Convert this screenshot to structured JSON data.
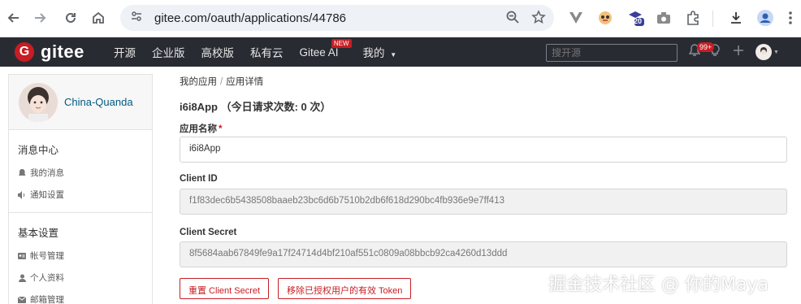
{
  "browser": {
    "url": "gitee.com/oauth/applications/44786",
    "extension_badge": "20"
  },
  "gitee_header": {
    "logo_text": "gitee",
    "logo_letter": "G",
    "nav": [
      "开源",
      "企业版",
      "高校版",
      "私有云",
      "Gitee AI",
      "我的"
    ],
    "new_tag": "NEW",
    "search_placeholder": "搜开源",
    "notification_badge": "99+"
  },
  "sidebar": {
    "username": "China-Quanda",
    "groups": [
      {
        "title": "消息中心",
        "items": [
          "我的消息",
          "通知设置"
        ]
      },
      {
        "title": "基本设置",
        "items": [
          "帐号管理",
          "个人资料",
          "邮箱管理"
        ]
      }
    ]
  },
  "breadcrumb": {
    "parent": "我的应用",
    "separator": "/",
    "current": "应用详情"
  },
  "app": {
    "title": "i6i8App （今日请求次数: 0 次）",
    "name_label": "应用名称",
    "required_mark": "*",
    "name_value": "i6i8App",
    "client_id_label": "Client ID",
    "client_id_value": "f1f83dec6b5438508baaeb23bc6d6b7510b2db6f618d290bc4fb936e9e7ff413",
    "client_secret_label": "Client Secret",
    "client_secret_value": "8f5684aab67849fe9a17f24714d4bf210af551c0809a08bbcb92ca4260d13ddd"
  },
  "buttons": {
    "reset_secret": "重置 Client Secret",
    "revoke_tokens": "移除已授权用户的有效 Token"
  },
  "watermark": "掘金技术社区 @ 你的Maya",
  "colors": {
    "brand": "#c71d23",
    "header_bg": "#292b33",
    "link": "#005980"
  }
}
